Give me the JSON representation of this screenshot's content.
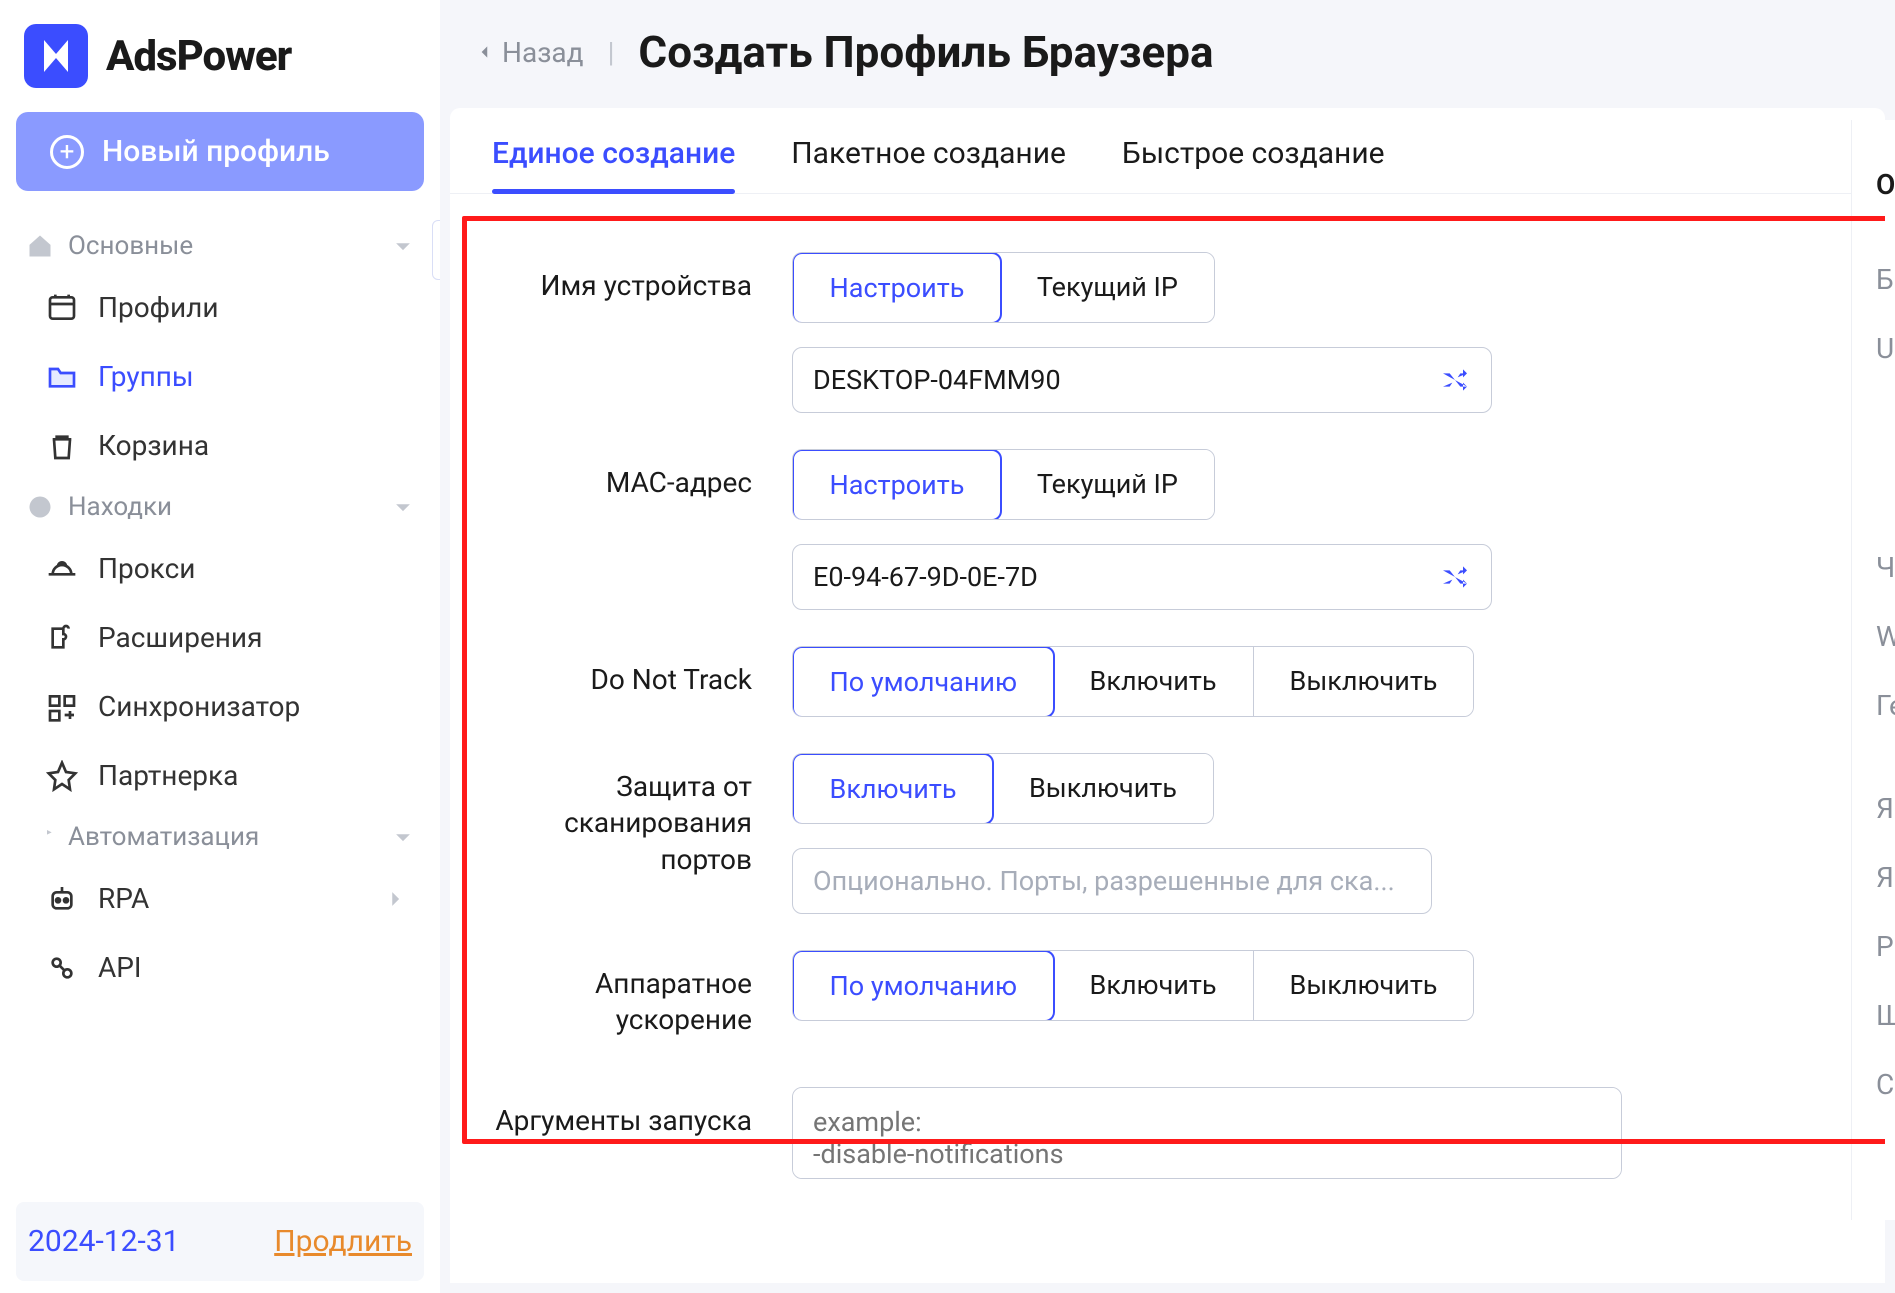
{
  "logo": {
    "text": "AdsPower"
  },
  "sidebar": {
    "newProfile": "Новый профиль",
    "sections": {
      "main": "Основные",
      "finds": "Находки",
      "auto": "Автоматизация"
    },
    "items": {
      "profiles": "Профили",
      "groups": "Группы",
      "trash": "Корзина",
      "proxy": "Прокси",
      "extensions": "Расширения",
      "sync": "Синхронизатор",
      "partner": "Партнерка",
      "rpa": "RPA",
      "api": "API"
    },
    "date": "2024-12-31",
    "renew": "Продлить"
  },
  "header": {
    "back": "Назад",
    "title": "Создать Профиль Браузера"
  },
  "tabs": {
    "single": "Единое создание",
    "batch": "Пакетное создание",
    "quick": "Быстрое создание"
  },
  "form": {
    "deviceName": {
      "label": "Имя устройства",
      "optConfigure": "Настроить",
      "optCurrentIp": "Текущий IP",
      "value": "DESKTOP-04FMM90"
    },
    "mac": {
      "label": "MAC-адрес",
      "optConfigure": "Настроить",
      "optCurrentIp": "Текущий IP",
      "value": "E0-94-67-9D-0E-7D"
    },
    "dnt": {
      "label": "Do Not Track",
      "optDefault": "По умолчанию",
      "optOn": "Включить",
      "optOff": "Выключить"
    },
    "portScan": {
      "label": "Защита от сканирования портов",
      "optOn": "Включить",
      "optOff": "Выключить",
      "placeholder": "Опционально. Порты, разрешенные для ска..."
    },
    "hwAccel": {
      "label": "Аппаратное ускорение",
      "optDefault": "По умолчанию",
      "optOn": "Включить",
      "optOff": "Выключить"
    },
    "launchArgs": {
      "label": "Аргументы запуска",
      "placeholder": "example:\n-disable-notifications"
    }
  },
  "rightPanel": {
    "head": "О",
    "items": [
      "Бр",
      "Us",
      "Ча",
      "We",
      "Ге",
      "Яз",
      "Яз",
      "Ра",
      "Шр",
      "Ca"
    ]
  }
}
